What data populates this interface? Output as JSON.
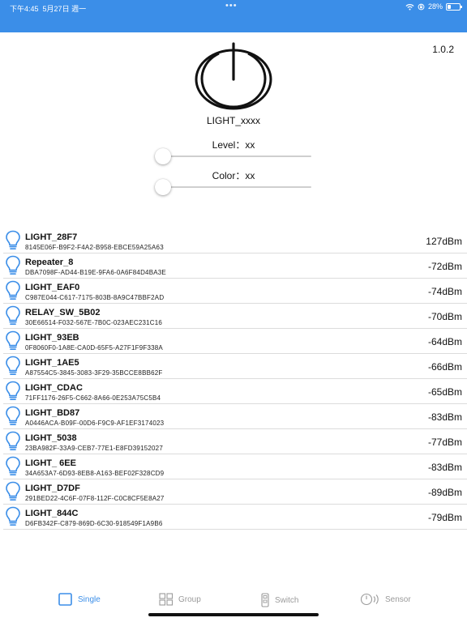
{
  "status_bar": {
    "time": "下午4:45",
    "date": "5月27日 週一",
    "dots": "•••",
    "battery_text": "28%",
    "battery_level": 0.28,
    "icons": [
      "wifi-icon",
      "orientation-lock-icon",
      "battery-icon"
    ]
  },
  "header": {
    "version": "1.0.2",
    "power_icon": "power-icon",
    "device_name": "LIGHT_xxxx"
  },
  "controls": {
    "level_label": "Level：xx",
    "level_value": 0,
    "color_label": "Color：xx",
    "color_value": 0
  },
  "devices": [
    {
      "name": "LIGHT_28F7",
      "uuid": "8145E06F-B9F2-F4A2-B958-EBCE59A25A63",
      "rssi": "127dBm"
    },
    {
      "name": "Repeater_8",
      "uuid": "DBA7098F-AD44-B19E-9FA6-0A6F84D4BA3E",
      "rssi": "-72dBm"
    },
    {
      "name": "LIGHT_EAF0",
      "uuid": "C987E044-C617-7175-803B-8A9C47BBF2AD",
      "rssi": "-74dBm"
    },
    {
      "name": "RELAY_SW_5B02",
      "uuid": "30E66514-F032-567E-7B0C-023AEC231C16",
      "rssi": "-70dBm"
    },
    {
      "name": "LIGHT_93EB",
      "uuid": "0F8060F0-1A8E-CA0D-65F5-A27F1F9F338A",
      "rssi": "-64dBm"
    },
    {
      "name": "LIGHT_1AE5",
      "uuid": "A87554C5-3845-3083-3F29-35BCCE8BB62F",
      "rssi": "-66dBm"
    },
    {
      "name": "LIGHT_CDAC",
      "uuid": "71FF1176-26F5-C662-8A66-0E253A75C5B4",
      "rssi": "-65dBm"
    },
    {
      "name": "LIGHT_BD87",
      "uuid": "A0446ACA-B09F-00D6-F9C9-AF1EF3174023",
      "rssi": "-83dBm"
    },
    {
      "name": "LIGHT_5038",
      "uuid": "23BA982F-33A9-CEB7-77E1-E8FD39152027",
      "rssi": "-77dBm"
    },
    {
      "name": "LIGHT_ 6EE",
      "uuid": "34A653A7-6D93-8EB8-A163-BEF02F328CD9",
      "rssi": "-83dBm"
    },
    {
      "name": "LIGHT_D7DF",
      "uuid": "291BED22-4C6F-07F8-112F-C0C8CF5E8A27",
      "rssi": "-89dBm"
    },
    {
      "name": "LIGHT_844C",
      "uuid": "D6FB342F-C879-869D-6C30-918549F1A9B6",
      "rssi": "-79dBm"
    }
  ],
  "tabs": [
    {
      "label": "Single",
      "icon": "square-icon",
      "active": true
    },
    {
      "label": "Group",
      "icon": "grid-icon",
      "active": false
    },
    {
      "label": "Switch",
      "icon": "remote-icon",
      "active": false
    },
    {
      "label": "Sensor",
      "icon": "sensor-icon",
      "active": false
    }
  ],
  "colors": {
    "accent": "#3b8ee8",
    "status_bar": "#3b8ee8",
    "inactive_tab": "#9a9a9a",
    "divider": "#dcdcdc"
  }
}
